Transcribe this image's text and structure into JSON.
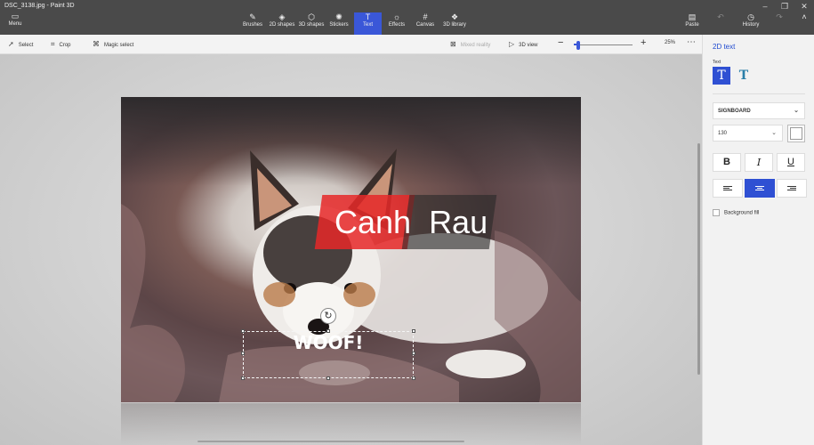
{
  "window": {
    "title": "DSC_3138.jpg - Paint 3D",
    "controls": [
      "–",
      "❐",
      "✕"
    ]
  },
  "ribbon": {
    "menu_label": "Menu",
    "menu_icon": "menu-icon",
    "tools": [
      {
        "label": "Brushes",
        "icon": "brush-icon"
      },
      {
        "label": "2D shapes",
        "icon": "2d-shapes-icon"
      },
      {
        "label": "3D shapes",
        "icon": "3d-shapes-icon"
      },
      {
        "label": "Stickers",
        "icon": "stickers-icon"
      },
      {
        "label": "Text",
        "icon": "text-icon",
        "active": true
      },
      {
        "label": "Effects",
        "icon": "effects-icon"
      },
      {
        "label": "Canvas",
        "icon": "canvas-icon"
      },
      {
        "label": "3D library",
        "icon": "3d-library-icon"
      }
    ],
    "right_tools": [
      {
        "label": "Paste",
        "icon": "paste-icon"
      },
      {
        "label": "History",
        "icon": "history-icon"
      }
    ]
  },
  "subbar": {
    "select_label": "Select",
    "crop_label": "Crop",
    "magic_select_label": "Magic select",
    "mixed_reality_label": "Mixed reality",
    "view_3d_label": "3D view",
    "zoom_minus": "−",
    "zoom_plus": "+",
    "zoom_level": "25%",
    "zoom_fraction": 0.08,
    "more": "⋯"
  },
  "canvas": {
    "watermark_left": "Canh",
    "watermark_right": "Rau",
    "text_content": "WOOF!",
    "accent": "#3a57d8",
    "watermark_red": "#e62828"
  },
  "panel": {
    "title": "2D text",
    "text_label": "Text",
    "font_name": "SIGNBOARD",
    "font_size": "130",
    "bold": "B",
    "italic": "I",
    "underline": "U",
    "background_fill_label": "Background fill",
    "alignment": [
      "left",
      "center",
      "right"
    ],
    "alignment_selected": "center",
    "text_color": "#ffffff"
  }
}
